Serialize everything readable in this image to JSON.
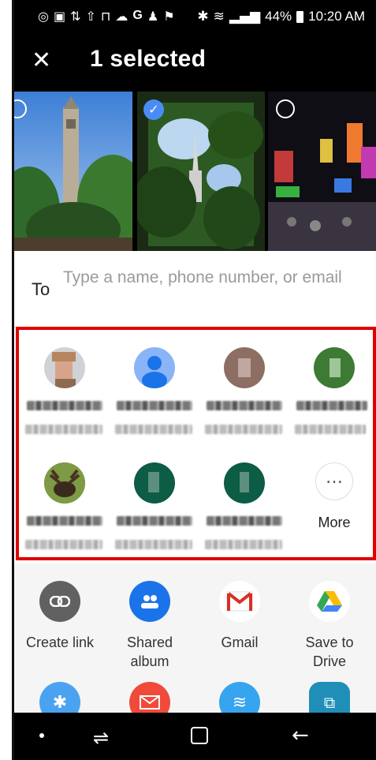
{
  "status_bar": {
    "battery": "44%",
    "time": "10:20 AM"
  },
  "header": {
    "title": "1 selected"
  },
  "photos": [
    {
      "name": "Campanile tower",
      "selected": false
    },
    {
      "name": "Chrysler building through trees",
      "selected": true
    },
    {
      "name": "Times Square night",
      "selected": false
    }
  ],
  "to_field": {
    "label": "To",
    "placeholder": "Type a name, phone number, or email"
  },
  "contacts_more_label": "More",
  "share_targets": [
    {
      "label": "Create link",
      "color": "#616161",
      "icon": "link-icon"
    },
    {
      "label": "Shared album",
      "color": "#1a73e8",
      "icon": "people-icon"
    },
    {
      "label": "Gmail",
      "color": "#ffffff",
      "icon": "gmail-icon"
    },
    {
      "label": "Save to Drive",
      "color": "#ffffff",
      "icon": "drive-icon"
    }
  ],
  "share_targets_row2_icons": [
    "bluetooth-icon",
    "mail-icon",
    "wifi-direct-icon",
    "smart-switch-icon"
  ],
  "colors": {
    "accent_blue": "#4a8cf5",
    "highlight_red": "#e00000"
  }
}
